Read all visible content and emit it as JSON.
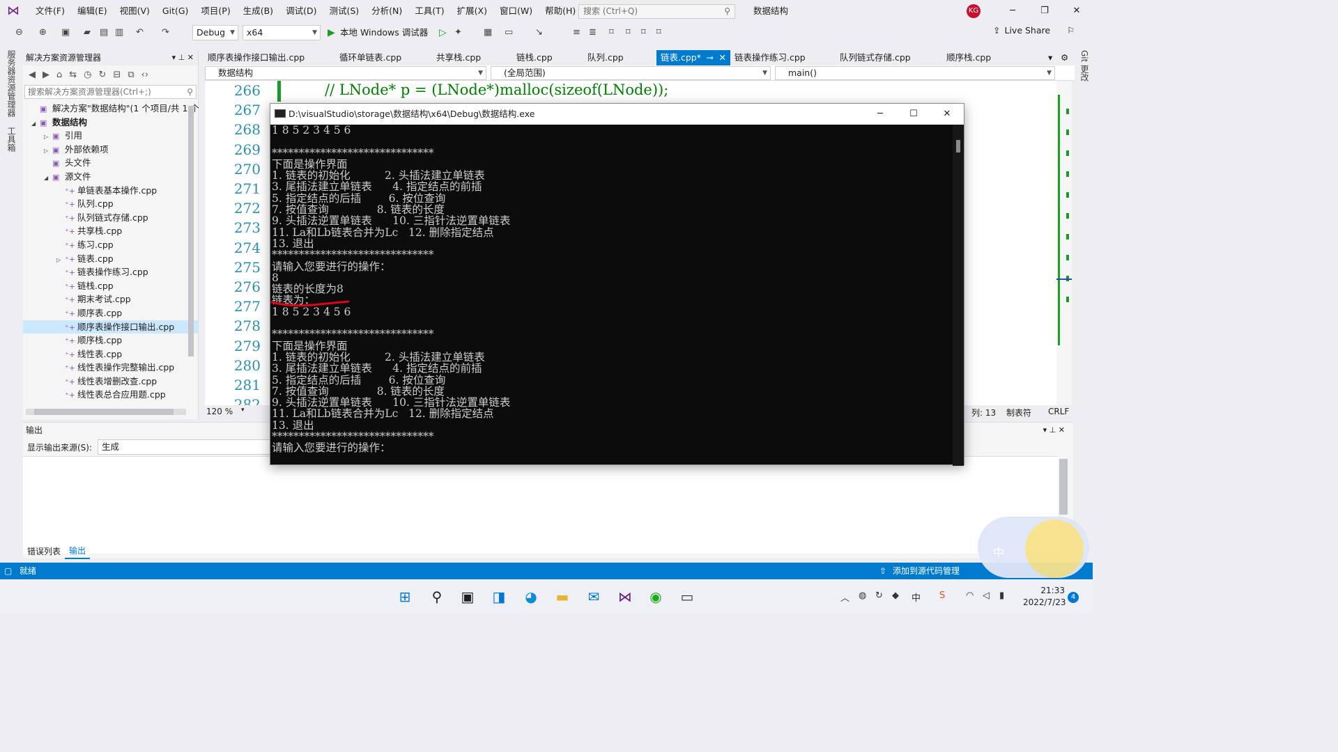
{
  "menu": [
    "文件(F)",
    "编辑(E)",
    "视图(V)",
    "Git(G)",
    "项目(P)",
    "生成(B)",
    "调试(D)",
    "测试(S)",
    "分析(N)",
    "工具(T)",
    "扩展(X)",
    "窗口(W)",
    "帮助(H)"
  ],
  "search_placeholder": "搜索 (Ctrl+Q)",
  "app_title": "数据结构",
  "avatar_initials": "KG",
  "toolbar": {
    "config": "Debug",
    "platform": "x64",
    "debugger": "本地 Windows 调试器",
    "live_share": "Live Share"
  },
  "left_tabs": [
    "服务器资源管理器",
    "工具箱"
  ],
  "right_tabs": [
    "Git 更改"
  ],
  "solution_explorer": {
    "title": "解决方案资源管理器",
    "search_placeholder": "搜索解决方案资源管理器(Ctrl+;)",
    "nodes": [
      {
        "label": "解决方案\"数据结构\"(1 个项目/共 1 个",
        "level": 0,
        "expand": ""
      },
      {
        "label": "数据结构",
        "level": 0,
        "expand": "◢"
      },
      {
        "label": "引用",
        "level": 1,
        "expand": "▷"
      },
      {
        "label": "外部依赖项",
        "level": 1,
        "expand": "▷"
      },
      {
        "label": "头文件",
        "level": 1,
        "expand": ""
      },
      {
        "label": "源文件",
        "level": 1,
        "expand": "◢"
      },
      {
        "label": "单链表基本操作.cpp",
        "level": 2,
        "expand": ""
      },
      {
        "label": "队列.cpp",
        "level": 2,
        "expand": ""
      },
      {
        "label": "队列链式存储.cpp",
        "level": 2,
        "expand": ""
      },
      {
        "label": "共享栈.cpp",
        "level": 2,
        "expand": ""
      },
      {
        "label": "练习.cpp",
        "level": 2,
        "expand": ""
      },
      {
        "label": "链表.cpp",
        "level": 2,
        "expand": "▷"
      },
      {
        "label": "链表操作练习.cpp",
        "level": 2,
        "expand": ""
      },
      {
        "label": "链栈.cpp",
        "level": 2,
        "expand": ""
      },
      {
        "label": "期末考试.cpp",
        "level": 2,
        "expand": ""
      },
      {
        "label": "顺序表.cpp",
        "level": 2,
        "expand": ""
      },
      {
        "label": "顺序表操作接口输出.cpp",
        "level": 2,
        "expand": "",
        "selected": true
      },
      {
        "label": "顺序栈.cpp",
        "level": 2,
        "expand": ""
      },
      {
        "label": "线性表.cpp",
        "level": 2,
        "expand": ""
      },
      {
        "label": "线性表操作完整输出.cpp",
        "level": 2,
        "expand": ""
      },
      {
        "label": "线性表增删改查.cpp",
        "level": 2,
        "expand": ""
      },
      {
        "label": "线性表总合应用题.cpp",
        "level": 2,
        "expand": ""
      }
    ]
  },
  "doc_tabs": [
    {
      "label": "顺序表操作接口输出.cpp"
    },
    {
      "label": "循环单链表.cpp"
    },
    {
      "label": "共享栈.cpp"
    },
    {
      "label": "链栈.cpp"
    },
    {
      "label": "队列.cpp"
    },
    {
      "label": "链表.cpp*",
      "active": true
    },
    {
      "label": "链表操作练习.cpp"
    },
    {
      "label": "队列链式存储.cpp"
    },
    {
      "label": "顺序栈.cpp"
    }
  ],
  "nav": {
    "project": "数据结构",
    "scope": "(全局范围)",
    "member": "main()"
  },
  "editor": {
    "line_numbers": [
      "266",
      "267",
      "268",
      "269",
      "270",
      "271",
      "272",
      "273",
      "274",
      "275",
      "276",
      "277",
      "278",
      "279",
      "280",
      "281",
      "282"
    ],
    "code_line": "// LNode* p = (LNode*)malloc(sizeof(LNode));"
  },
  "zoom": "120 %",
  "editor_status": {
    "col": "列: 13",
    "tabs": "制表符",
    "eol": "CRLF"
  },
  "output": {
    "title": "输出",
    "source_label": "显示输出来源(S):",
    "source_value": "生成"
  },
  "bottom_tabs": [
    "错误列表",
    "输出"
  ],
  "status": {
    "ready": "就绪",
    "source_control": "添加到源代码管理"
  },
  "console": {
    "title": "D:\\visualStudio\\storage\\数据结构\\x64\\Debug\\数据结构.exe",
    "lines": [
      "1 8 5 2 3 4 5 6",
      "",
      "******************************",
      "下面是操作界面",
      "1. 链表的初始化          2. 头插法建立单链表",
      "3. 尾插法建立单链表      4. 指定结点的前插",
      "5. 指定结点的后插        6. 按位查询",
      "7. 按值查询              8. 链表的长度",
      "9. 头插法逆置单链表      10. 三指针法逆置单链表",
      "11. La和Lb链表合并为Lc   12. 删除指定结点",
      "13. 退出",
      "******************************",
      "请输入您要进行的操作：",
      "8",
      "链表的长度为8",
      "链表为：",
      "1 8 5 2 3 4 5 6",
      "",
      "******************************",
      "下面是操作界面",
      "1. 链表的初始化          2. 头插法建立单链表",
      "3. 尾插法建立单链表      4. 指定结点的前插",
      "5. 指定结点的后插        6. 按位查询",
      "7. 按值查询              8. 链表的长度",
      "9. 头插法逆置单链表      10. 三指针法逆置单链表",
      "11. La和Lb链表合并为Lc   12. 删除指定结点",
      "13. 退出",
      "******************************",
      "请输入您要进行的操作："
    ]
  },
  "taskbar": {
    "time": "21:33",
    "date": "2022/7/23",
    "notif": "4"
  },
  "colors": {
    "accent": "#007acc",
    "vs_purple": "#68217a",
    "code_green": "#008000",
    "line_num": "#2b91af",
    "annotation_red": "#e0001b"
  }
}
